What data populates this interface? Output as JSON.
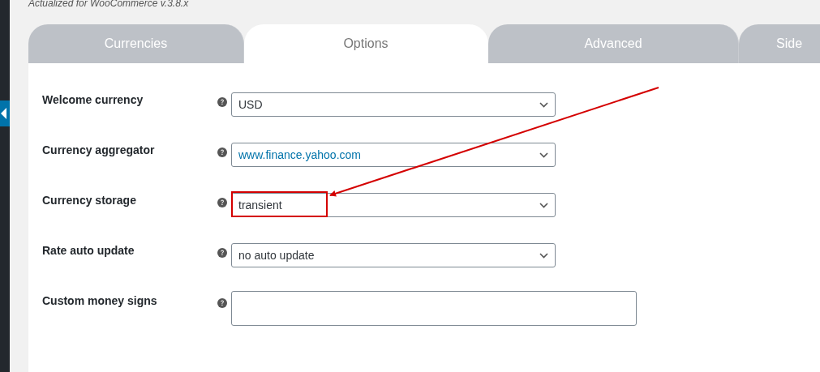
{
  "subtitle": "Actualized for WooCommerce v.3.8.x",
  "tabs": [
    {
      "label": "Currencies",
      "selected": false
    },
    {
      "label": "Options",
      "selected": true
    },
    {
      "label": "Advanced",
      "selected": false
    },
    {
      "label": "Side",
      "selected": false
    }
  ],
  "settings": [
    {
      "label": "Welcome currency",
      "kind": "select",
      "value": "USD",
      "focused": false
    },
    {
      "label": "Currency aggregator",
      "kind": "select",
      "value": "www.finance.yahoo.com",
      "focused": true
    },
    {
      "label": "Currency storage",
      "kind": "select",
      "value": "transient",
      "focused": false
    },
    {
      "label": "Rate auto update",
      "kind": "select",
      "value": "no auto update",
      "focused": false
    },
    {
      "label": "Custom money signs",
      "kind": "textarea"
    }
  ]
}
